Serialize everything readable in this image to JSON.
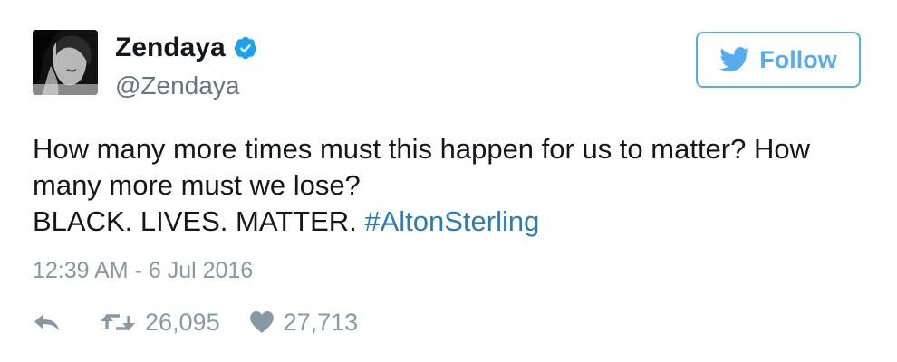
{
  "author": {
    "display_name": "Zendaya",
    "handle": "@Zendaya",
    "verified": true,
    "avatar_icon": "profile-photo"
  },
  "follow_button": {
    "label": "Follow",
    "icon": "twitter-bird-icon",
    "color": "#55acee"
  },
  "tweet": {
    "lines": [
      "How many more times must this happen for us to matter? How",
      "many more must we lose?",
      "BLACK. LIVES. MATTER. "
    ],
    "hashtag": "#AltonSterling",
    "timestamp": "12:39 AM - 6 Jul 2016"
  },
  "actions": {
    "reply_icon": "reply-icon",
    "retweet_icon": "retweet-icon",
    "retweet_count": "26,095",
    "like_icon": "heart-icon",
    "like_count": "27,713"
  },
  "colors": {
    "link": "#2b7bb9",
    "muted": "#8899a6",
    "verified_badge": "#1da1f2"
  }
}
